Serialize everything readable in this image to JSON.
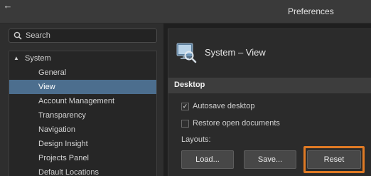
{
  "window": {
    "back_glyph": "←",
    "title": "Preferences"
  },
  "search": {
    "placeholder": "Search",
    "value": "",
    "icon": "search-icon"
  },
  "tree": {
    "root": {
      "label": "System",
      "expanded": true,
      "caret": "▲"
    },
    "items": [
      {
        "label": "General",
        "selected": false
      },
      {
        "label": "View",
        "selected": true
      },
      {
        "label": "Account Management",
        "selected": false
      },
      {
        "label": "Transparency",
        "selected": false
      },
      {
        "label": "Navigation",
        "selected": false
      },
      {
        "label": "Design Insight",
        "selected": false
      },
      {
        "label": "Projects Panel",
        "selected": false
      },
      {
        "label": "Default Locations",
        "selected": false
      }
    ]
  },
  "page": {
    "icon": "system-view-icon",
    "title": "System – View"
  },
  "desktop": {
    "header": "Desktop",
    "autosave": {
      "label": "Autosave desktop",
      "checked": true,
      "mark": "✓"
    },
    "restore": {
      "label": "Restore open documents",
      "checked": false
    },
    "layouts_label": "Layouts:",
    "buttons": {
      "load": "Load...",
      "save": "Save...",
      "reset": "Reset"
    }
  },
  "colors": {
    "highlight": "#e07a24",
    "selection": "#4c6e8e"
  }
}
